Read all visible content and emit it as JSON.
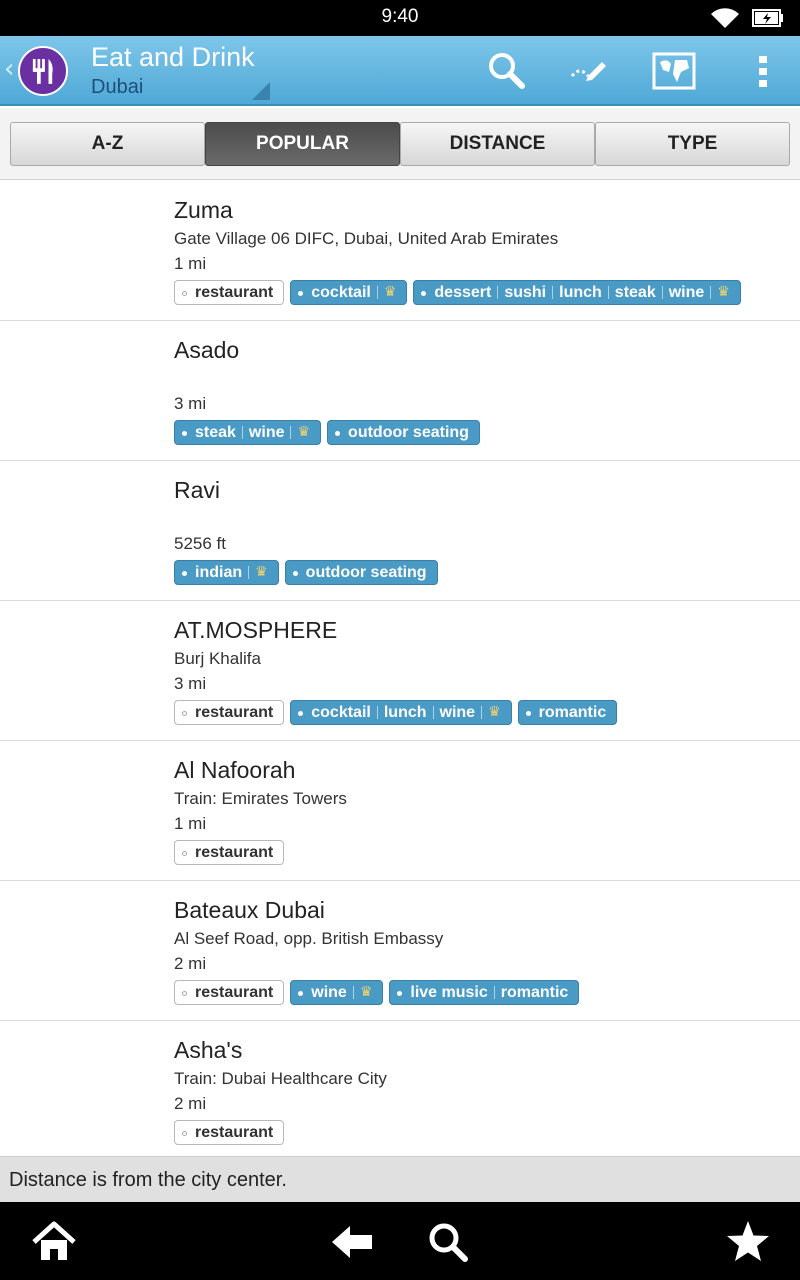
{
  "status_bar": {
    "time": "9:40",
    "icons": [
      "wifi-icon",
      "battery-charging-icon"
    ]
  },
  "action_bar": {
    "title": "Eat and Drink",
    "subtitle": "Dubai",
    "app_icon": "fork-knife-icon",
    "actions": [
      "search-icon",
      "edit-route-icon",
      "map-icon",
      "overflow-menu-icon"
    ],
    "accent_color": "#4fa9d6"
  },
  "tabs": [
    {
      "label": "A-Z",
      "selected": false
    },
    {
      "label": "POPULAR",
      "selected": true
    },
    {
      "label": "DISTANCE",
      "selected": false
    },
    {
      "label": "TYPE",
      "selected": false
    }
  ],
  "places": [
    {
      "name": "Zuma",
      "address": "Gate Village 06 DIFC, Dubai, United Arab Emirates",
      "distance": "1 mi",
      "tags": [
        {
          "style": "plain",
          "words": [
            "restaurant"
          ],
          "crown": false
        },
        {
          "style": "blue",
          "words": [
            "cocktail"
          ],
          "crown": true
        },
        {
          "style": "blue",
          "words": [
            "dessert",
            "sushi",
            "lunch",
            "steak",
            "wine"
          ],
          "crown": true
        }
      ]
    },
    {
      "name": "Asado",
      "address": "",
      "distance": "3 mi",
      "tags": [
        {
          "style": "blue",
          "words": [
            "steak",
            "wine"
          ],
          "crown": true
        },
        {
          "style": "blue",
          "words": [
            "outdoor seating"
          ],
          "crown": false
        }
      ]
    },
    {
      "name": "Ravi",
      "address": "",
      "distance": "5256 ft",
      "tags": [
        {
          "style": "blue",
          "words": [
            "indian"
          ],
          "crown": true
        },
        {
          "style": "blue",
          "words": [
            "outdoor seating"
          ],
          "crown": false
        }
      ]
    },
    {
      "name": "AT.MOSPHERE",
      "address": "Burj Khalifa",
      "distance": "3 mi",
      "tags": [
        {
          "style": "plain",
          "words": [
            "restaurant"
          ],
          "crown": false
        },
        {
          "style": "blue",
          "words": [
            "cocktail",
            "lunch",
            "wine"
          ],
          "crown": true
        },
        {
          "style": "blue",
          "words": [
            "romantic"
          ],
          "crown": false
        }
      ]
    },
    {
      "name": "Al Nafoorah",
      "address": "Train: Emirates Towers",
      "distance": "1 mi",
      "tags": [
        {
          "style": "plain",
          "words": [
            "restaurant"
          ],
          "crown": false
        }
      ]
    },
    {
      "name": "Bateaux Dubai",
      "address": "Al Seef Road, opp. British Embassy",
      "distance": "2 mi",
      "tags": [
        {
          "style": "plain",
          "words": [
            "restaurant"
          ],
          "crown": false
        },
        {
          "style": "blue",
          "words": [
            "wine"
          ],
          "crown": true
        },
        {
          "style": "blue",
          "words": [
            "live music",
            "romantic"
          ],
          "crown": false
        }
      ]
    },
    {
      "name": "Asha's",
      "address": "Train: Dubai Healthcare City",
      "distance": "2 mi",
      "tags": [
        {
          "style": "plain",
          "words": [
            "restaurant"
          ],
          "crown": false
        }
      ]
    }
  ],
  "footer_note": "Distance is from the city center.",
  "nav_bar": [
    "home-icon",
    "back-icon",
    "search-icon",
    "favorite-star-icon"
  ]
}
